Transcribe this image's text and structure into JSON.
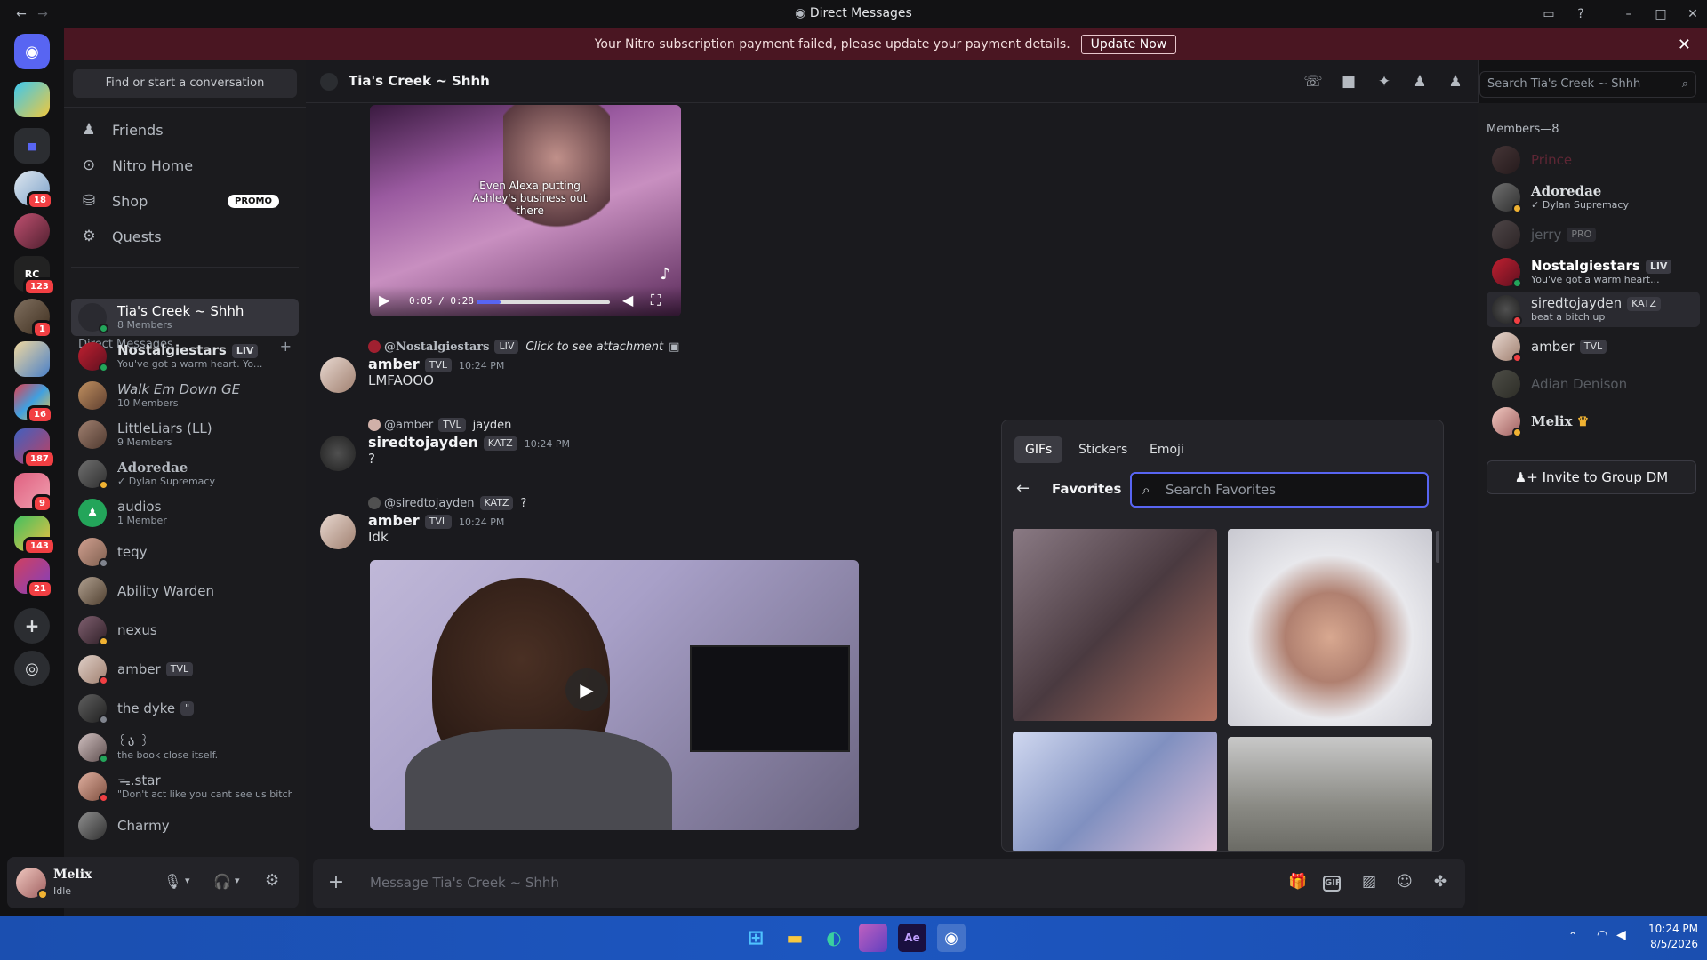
{
  "window": {
    "title": "Direct Messages"
  },
  "banner": {
    "text": "Your Nitro subscription payment failed, please update your payment details.",
    "button": "Update Now"
  },
  "servers": {
    "badges": [
      "18",
      "123",
      "1",
      "16",
      "187",
      "9",
      "143",
      "21"
    ]
  },
  "sidebar": {
    "find": "Find or start a conversation",
    "nav": [
      {
        "label": "Friends",
        "icon": "friends-icon"
      },
      {
        "label": "Nitro Home",
        "icon": "nitro-icon"
      },
      {
        "label": "Shop",
        "icon": "shop-icon"
      },
      {
        "label": "Quests",
        "icon": "quests-icon"
      }
    ],
    "promo": "PROMO",
    "dm_header": "Direct Messages",
    "dms": [
      {
        "name": "Tia's Creek ~ Shhh",
        "sub": "8 Members"
      },
      {
        "name": "Nostalgiestars",
        "tag": "LIV",
        "sub": "You've got a warm heart. Yo..."
      },
      {
        "name": "Walk Em Down GE",
        "sub": "10 Members"
      },
      {
        "name": "LittleLiars (LL)",
        "sub": "9 Members"
      },
      {
        "name": "Adoredae",
        "sub": "Dylan Supremacy"
      },
      {
        "name": "audios",
        "sub": "1 Member"
      },
      {
        "name": "teqy",
        "sub": ""
      },
      {
        "name": "Ability Warden",
        "sub": ""
      },
      {
        "name": "nexus",
        "sub": ""
      },
      {
        "name": "amber",
        "tag": "TVL",
        "sub": ""
      },
      {
        "name": "the dyke",
        "tag": "\"",
        "sub": ""
      },
      {
        "name": "꒰ა ꒱",
        "sub": "the book close itself."
      },
      {
        "name": "ᯓ.star",
        "sub": "\"Don't act like you cant see us bitch\""
      },
      {
        "name": "Charmy",
        "sub": ""
      }
    ]
  },
  "user": {
    "name": "Melix",
    "status": "Idle"
  },
  "chat": {
    "channel": "Tia's Creek ~ Shhh",
    "search_placeholder": "Search Tia's Creek ~ Shhh",
    "video_caption": "Even Alexa putting Ashley's business out there",
    "video_time": "0:05 / 0:28",
    "messages": [
      {
        "reply_user": "@Nostalgiestars",
        "reply_tag": "LIV",
        "reply_text": "Click to see attachment",
        "author": "amber",
        "tag": "TVL",
        "time": "10:24 PM",
        "text": "LMFAOOO"
      },
      {
        "reply_user": "@amber",
        "reply_tag": "TVL",
        "reply_text": "jayden",
        "author": "siredtojayden",
        "tag": "KATZ",
        "time": "10:24 PM",
        "text": "?"
      },
      {
        "reply_user": "@siredtojayden",
        "reply_tag": "KATZ",
        "reply_text": "?",
        "author": "amber",
        "tag": "TVL",
        "time": "10:24 PM",
        "text": "Idk"
      }
    ],
    "input_placeholder": "Message Tia's Creek ~ Shhh"
  },
  "gif_picker": {
    "tabs": [
      "GIFs",
      "Stickers",
      "Emoji"
    ],
    "section": "Favorites",
    "search_placeholder": "Search Favorites"
  },
  "members": {
    "header": "Members—8",
    "list": [
      {
        "name": "Prince",
        "sub": "",
        "color": "#a0324a"
      },
      {
        "name": "Adoredae",
        "sub": "Dylan Supremacy",
        "color": "#dbdee1"
      },
      {
        "name": "jerry",
        "tag": "PRO",
        "sub": "",
        "color": "#6d6f78"
      },
      {
        "name": "Nostalgiestars",
        "tag": "LIV",
        "sub": "You've got a warm heart...",
        "color": "#ffffff"
      },
      {
        "name": "siredtojayden",
        "tag": "KATZ",
        "sub": "beat a bitch up",
        "color": "#dbdee1"
      },
      {
        "name": "amber",
        "tag": "TVL",
        "sub": "",
        "color": "#dbdee1"
      },
      {
        "name": "Adian Denison",
        "sub": "",
        "color": "#6d6f78"
      },
      {
        "name": "Melix",
        "sub": "",
        "color": "#dbdee1"
      }
    ],
    "invite": "Invite to Group DM"
  },
  "taskbar": {
    "time": "10:24 PM",
    "date": "8/5/2026"
  }
}
